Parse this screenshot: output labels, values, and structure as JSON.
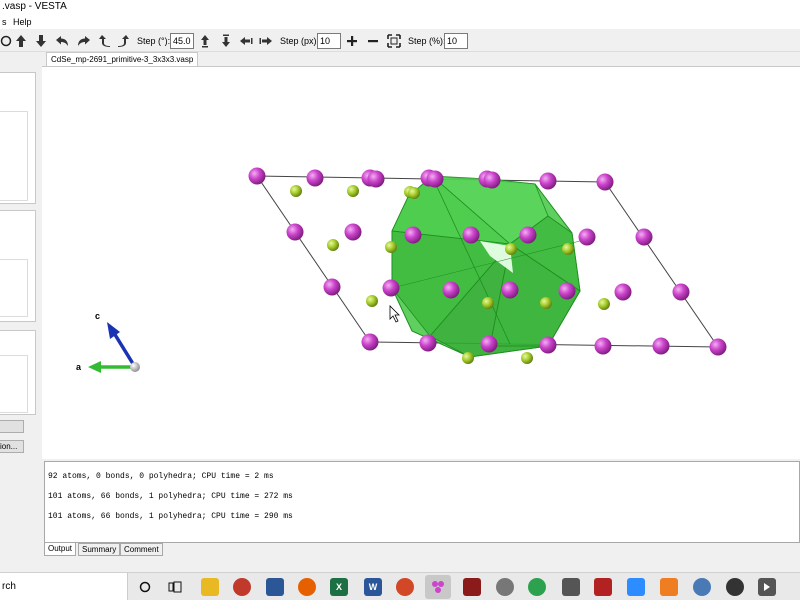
{
  "window": {
    "title": ".vasp - VESTA"
  },
  "menu": {
    "items": [
      "s",
      "Help"
    ]
  },
  "toolbar": {
    "step_deg_label": "Step (°):",
    "step_deg_value": "45.0",
    "step_px_label": "Step (px):",
    "step_px_value": "10",
    "step_pct_label": "Step (%):",
    "step_pct_value": "10",
    "icons": [
      "rotate-icon",
      "arrow-up-icon",
      "arrow-down-icon",
      "undo-icon",
      "redo-icon",
      "rotate-ccw-icon",
      "rotate-cw-icon",
      "step-up-icon",
      "step-down-icon",
      "step-left-icon",
      "step-right-icon",
      "zoom-in-icon",
      "zoom-out-icon",
      "fit-icon"
    ]
  },
  "left_panel": {
    "button_label": "ion..."
  },
  "document": {
    "tab_label": "CdSe_mp-2691_primitive-3_3x3x3.vasp"
  },
  "axes": {
    "c_label": "c",
    "a_label": "a"
  },
  "output": {
    "lines": [
      "92 atoms, 0 bonds, 0 polyhedra; CPU time = 2 ms",
      "101 atoms, 66 bonds, 1 polyhedra; CPU time = 272 ms",
      "101 atoms, 66 bonds, 1 polyhedra; CPU time = 290 ms"
    ]
  },
  "bottom_tabs": [
    "Output",
    "Summary",
    "Comment"
  ],
  "taskbar": {
    "search_text": "rch"
  },
  "colors": {
    "cd_atom": "#cc44cc",
    "se_atom": "#a4cc2a",
    "polyhedron": "#2fbf2f",
    "axis_c": "#1a33b3",
    "axis_a": "#33bb33"
  }
}
